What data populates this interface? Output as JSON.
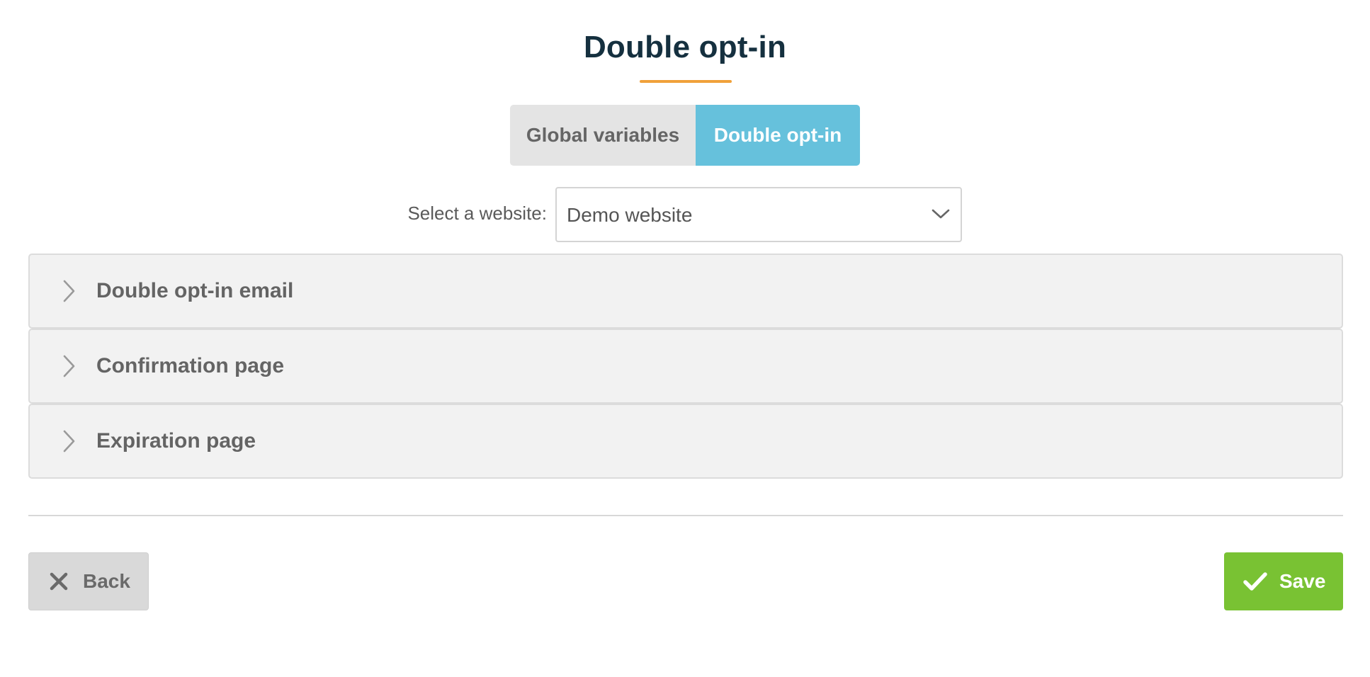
{
  "header": {
    "title": "Double opt-in"
  },
  "tabs": [
    {
      "label": "Global variables",
      "active": false
    },
    {
      "label": "Double opt-in",
      "active": true
    }
  ],
  "website_select": {
    "label": "Select a website:",
    "value": "Demo website"
  },
  "sections": [
    {
      "label": "Double opt-in email",
      "expanded": false
    },
    {
      "label": "Confirmation page",
      "expanded": false
    },
    {
      "label": "Expiration page",
      "expanded": false
    }
  ],
  "actions": {
    "back_label": "Back",
    "save_label": "Save"
  },
  "colors": {
    "accent_underline": "#f0a13a",
    "active_tab": "#66c1dc",
    "save_button": "#79c233",
    "title": "#15303f"
  },
  "icons": {
    "select": "chevron-down-icon",
    "section": "chevron-right-icon",
    "back": "close-icon",
    "save": "check-icon"
  }
}
